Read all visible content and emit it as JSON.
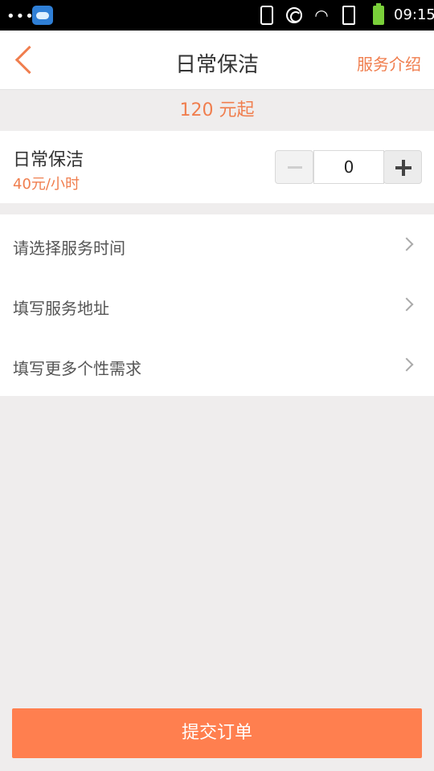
{
  "status_bar": {
    "dots": "•••",
    "time": "09:15",
    "icons": [
      "app-cloud-icon",
      "phone-vibrate-icon",
      "c-icon",
      "wifi-icon",
      "sd-card-icon",
      "battery-icon"
    ],
    "battery_color": "#7ad03a"
  },
  "header": {
    "title": "日常保洁",
    "right_link": "服务介绍",
    "back_icon": "chevron-left-icon",
    "accent_color": "#f07e4e"
  },
  "price": {
    "text": "120 元起"
  },
  "service": {
    "name": "日常保洁",
    "rate": "40元/小时",
    "quantity": "0"
  },
  "list": {
    "items": [
      {
        "label": "请选择服务时间"
      },
      {
        "label": "填写服务地址"
      },
      {
        "label": "填写更多个性需求"
      }
    ]
  },
  "submit": {
    "label": "提交订单",
    "color": "#ff7f4f"
  }
}
